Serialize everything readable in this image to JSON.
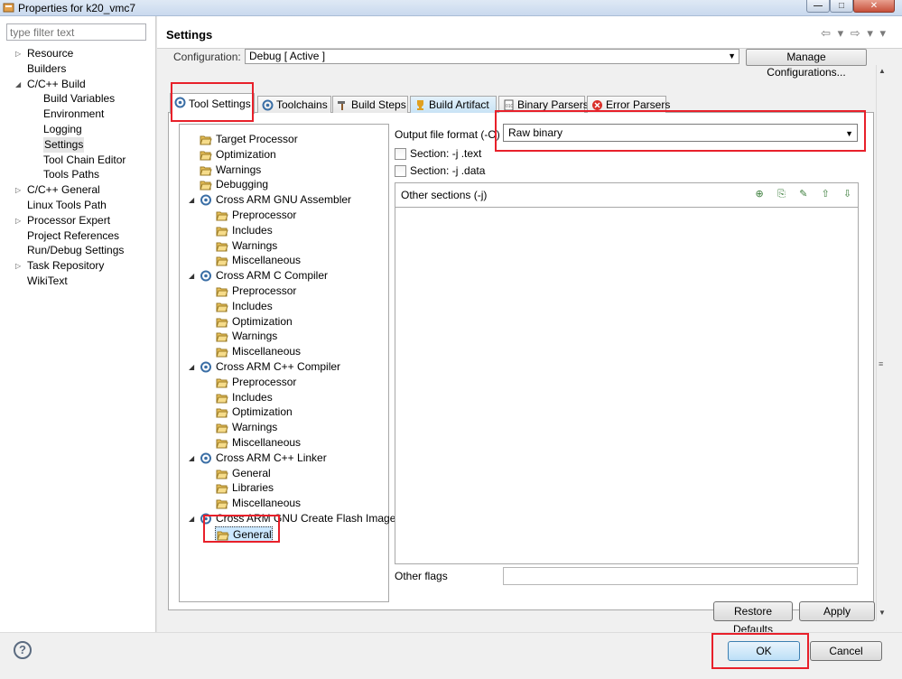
{
  "window": {
    "title": "Properties for k20_vmc7",
    "min_glyph": "—",
    "max_glyph": "□",
    "close_glyph": "✕"
  },
  "filter": {
    "placeholder": "type filter text"
  },
  "nav": {
    "items": [
      {
        "label": "Resource",
        "arrow": "▷"
      },
      {
        "label": "Builders",
        "arrow": ""
      },
      {
        "label": "C/C++ Build",
        "arrow": "◢"
      },
      {
        "label": "Build Variables",
        "arrow": ""
      },
      {
        "label": "Environment",
        "arrow": ""
      },
      {
        "label": "Logging",
        "arrow": ""
      },
      {
        "label": "Settings",
        "arrow": "",
        "selected": true
      },
      {
        "label": "Tool Chain Editor",
        "arrow": ""
      },
      {
        "label": "Tools Paths",
        "arrow": ""
      },
      {
        "label": "C/C++ General",
        "arrow": "▷"
      },
      {
        "label": "Linux Tools Path",
        "arrow": ""
      },
      {
        "label": "Processor Expert",
        "arrow": "▷"
      },
      {
        "label": "Project References",
        "arrow": ""
      },
      {
        "label": "Run/Debug Settings",
        "arrow": ""
      },
      {
        "label": "Task Repository",
        "arrow": "▷"
      },
      {
        "label": "WikiText",
        "arrow": ""
      }
    ]
  },
  "header": {
    "title": "Settings",
    "back_glyph": "⇦",
    "forward_glyph": "⇨",
    "menu_glyph": "▾"
  },
  "config": {
    "label": "Configuration:",
    "value": "Debug  [ Active ]",
    "manage_label": "Manage Configurations..."
  },
  "tabs": [
    {
      "label": "Tool Settings"
    },
    {
      "label": "Toolchains"
    },
    {
      "label": "Build Steps"
    },
    {
      "label": "Build Artifact"
    },
    {
      "label": "Binary Parsers"
    },
    {
      "label": "Error Parsers"
    }
  ],
  "tool_tree": [
    {
      "label": "Target Processor"
    },
    {
      "label": "Optimization"
    },
    {
      "label": "Warnings"
    },
    {
      "label": "Debugging"
    },
    {
      "label": "Cross ARM GNU Assembler"
    },
    {
      "label": "Preprocessor"
    },
    {
      "label": "Includes"
    },
    {
      "label": "Warnings"
    },
    {
      "label": "Miscellaneous"
    },
    {
      "label": "Cross ARM C Compiler"
    },
    {
      "label": "Preprocessor"
    },
    {
      "label": "Includes"
    },
    {
      "label": "Optimization"
    },
    {
      "label": "Warnings"
    },
    {
      "label": "Miscellaneous"
    },
    {
      "label": "Cross ARM C++ Compiler"
    },
    {
      "label": "Preprocessor"
    },
    {
      "label": "Includes"
    },
    {
      "label": "Optimization"
    },
    {
      "label": "Warnings"
    },
    {
      "label": "Miscellaneous"
    },
    {
      "label": "Cross ARM C++ Linker"
    },
    {
      "label": "General"
    },
    {
      "label": "Libraries"
    },
    {
      "label": "Miscellaneous"
    },
    {
      "label": "Cross ARM GNU Create Flash Image"
    },
    {
      "label": "General",
      "selected": true
    }
  ],
  "options": {
    "output_format_label": "Output file format (-O)",
    "output_format_value": "Raw binary",
    "section_text_label": "Section: -j .text",
    "section_data_label": "Section: -j .data",
    "other_sections_label": "Other sections (-j)",
    "other_flags_label": "Other flags",
    "tool_glyphs": [
      "⊕",
      "⎘",
      "✎",
      "⇧",
      "⇩"
    ]
  },
  "buttons": {
    "restore_defaults": "Restore Defaults",
    "apply": "Apply",
    "ok": "OK",
    "cancel": "Cancel",
    "help_glyph": "?"
  },
  "colors": {
    "highlight_red": "#e8202a",
    "selection_blue": "#cce8ff"
  }
}
